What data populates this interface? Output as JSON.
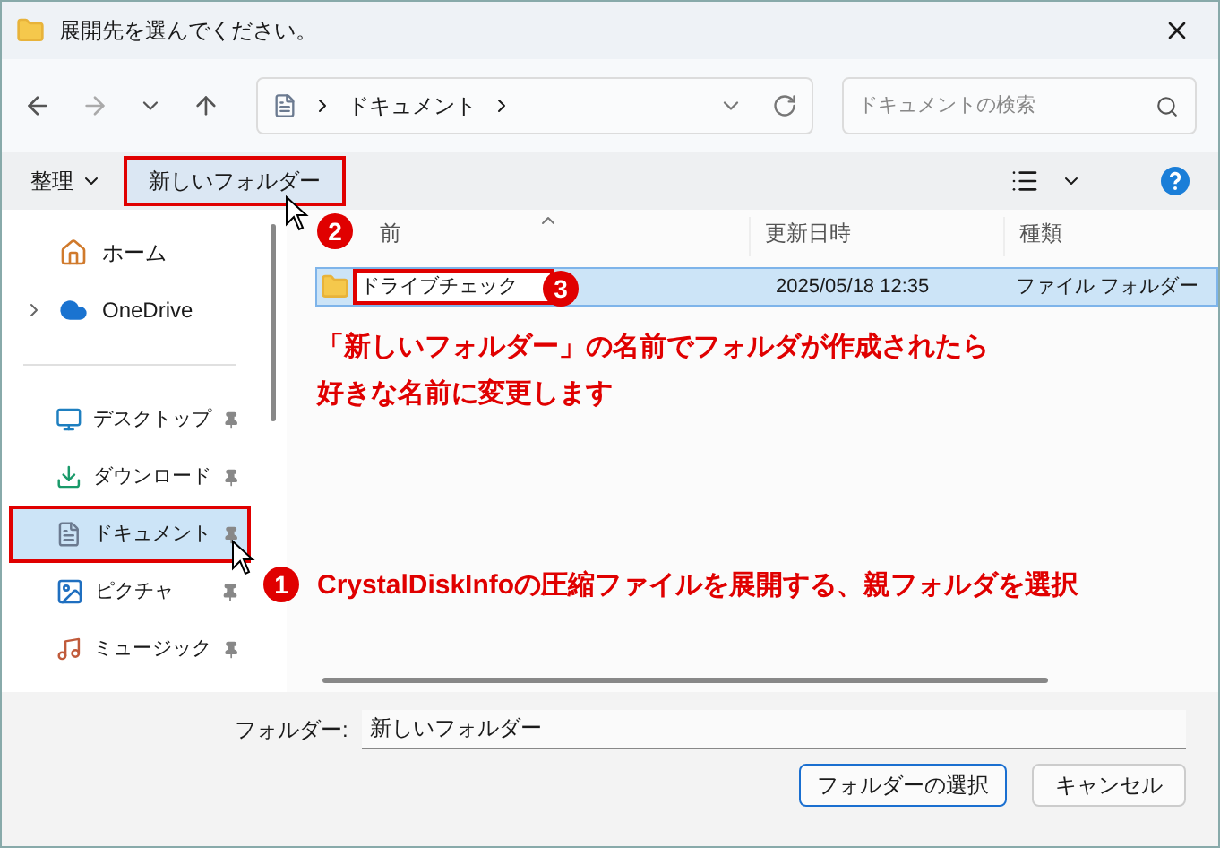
{
  "window": {
    "title": "展開先を選んでください。"
  },
  "nav": {
    "breadcrumb": [
      "ドキュメント"
    ],
    "search_placeholder": "ドキュメントの検索"
  },
  "toolbar": {
    "organize": "整理",
    "new_folder": {
      "label": "新しいフォルダー",
      "highlighted": true
    }
  },
  "sidebar": {
    "top": [
      {
        "label": "ホーム",
        "kind": "home",
        "expandable": false
      },
      {
        "label": "OneDrive",
        "kind": "cloud",
        "expandable": true
      }
    ],
    "pinned": [
      {
        "label": "デスクトップ",
        "kind": "desktop",
        "selected": false,
        "highlighted": false
      },
      {
        "label": "ダウンロード",
        "kind": "download",
        "selected": false,
        "highlighted": false
      },
      {
        "label": "ドキュメント",
        "kind": "documents",
        "selected": true,
        "highlighted": true
      },
      {
        "label": "ピクチャ",
        "kind": "pictures",
        "selected": false,
        "highlighted": false
      },
      {
        "label": "ミュージック",
        "kind": "music",
        "selected": false,
        "highlighted": false
      }
    ]
  },
  "table": {
    "columns": [
      "前",
      "更新日時",
      "種類"
    ],
    "rows": [
      {
        "name": "ドライブチェック",
        "modified": "2025/05/18  12:35",
        "type": "ファイル フォルダー",
        "selected": true,
        "renaming": true
      }
    ]
  },
  "annotations": {
    "badges": [
      "1",
      "2",
      "3"
    ],
    "step1": "CrystalDiskInfoの圧縮ファイルを展開する、親フォルダを選択",
    "note": [
      "「新しいフォルダー」の名前でフォルダが作成されたら",
      "好きな名前に変更します"
    ]
  },
  "footer": {
    "folder_label": "フォルダー:",
    "folder_value": "新しいフォルダー",
    "buttons": [
      {
        "label": "フォルダーの選択",
        "primary": true
      },
      {
        "label": "キャンセル",
        "primary": false
      }
    ]
  }
}
